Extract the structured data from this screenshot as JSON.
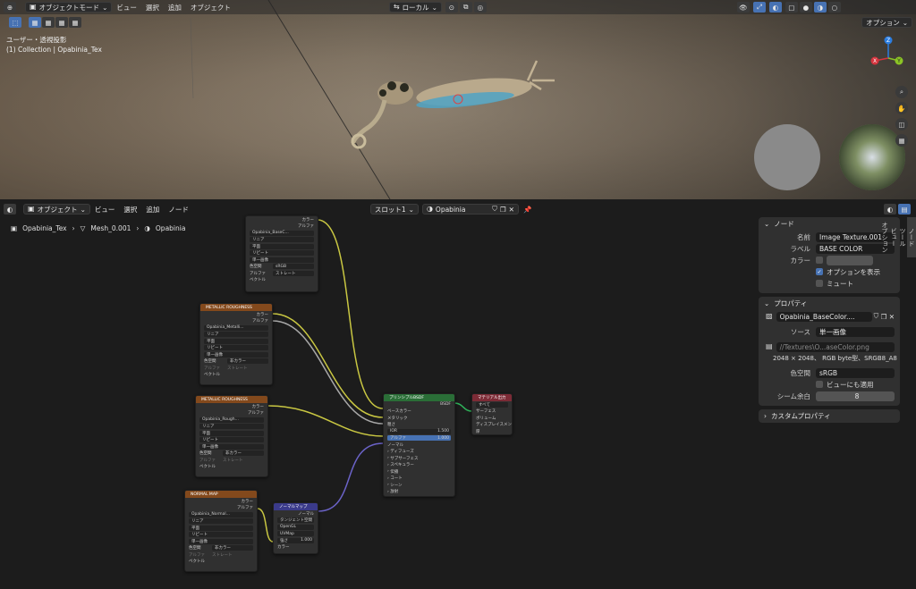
{
  "viewport_header": {
    "mode": "オブジェクトモード",
    "menus": [
      "ビュー",
      "選択",
      "追加",
      "オブジェクト"
    ],
    "pivot": "ローカル",
    "options": "オプション"
  },
  "viewport": {
    "view_name": "ユーザー・透視投影",
    "collection": "(1) Collection | Opabinia_Tex",
    "gizmo": {
      "x": "X",
      "y": "Y",
      "z": "Z"
    }
  },
  "node_header": {
    "mode": "オブジェクト",
    "menus": [
      "ビュー",
      "選択",
      "追加",
      "ノード"
    ],
    "slot": "スロット1",
    "material": "Opabinia"
  },
  "breadcrumb": [
    "Opabinia_Tex",
    "Mesh_0.001",
    "Opabinia"
  ],
  "nodes": {
    "tex1": {
      "title": "",
      "out_color": "カラー",
      "out_alpha": "アルファ",
      "image": "Opabinia_BaseC...",
      "interp": "リニア",
      "proj": "平面",
      "ext": "リピート",
      "src": "単一画像",
      "cs_label": "色空間",
      "cs": "sRGB",
      "a_label": "アルファ",
      "a": "ストレート",
      "vector": "ベクトル"
    },
    "tex2": {
      "title": "METALLIC ROUGHNESS",
      "out_color": "カラー",
      "out_alpha": "アルファ",
      "image": "Opabinia_Metalli...",
      "interp": "リニア",
      "proj": "平面",
      "ext": "リピート",
      "src": "単一画像",
      "cs_label": "色空間",
      "cs": "非カラー",
      "a_label": "アルファ",
      "a": "ストレート",
      "vector": "ベクトル"
    },
    "tex3": {
      "title": "METALLIC ROUGHNESS",
      "out_color": "カラー",
      "out_alpha": "アルファ",
      "image": "Opabinia_Rough...",
      "interp": "リニア",
      "proj": "平面",
      "ext": "リピート",
      "src": "単一画像",
      "cs_label": "色空間",
      "cs": "非カラー",
      "a_label": "アルファ",
      "a": "ストレート",
      "vector": "ベクトル"
    },
    "tex4": {
      "title": "NORMAL MAP",
      "out_color": "カラー",
      "out_alpha": "アルファ",
      "image": "Opabinia_Normal...",
      "interp": "リニア",
      "proj": "平面",
      "ext": "リピート",
      "src": "単一画像",
      "cs_label": "色空間",
      "cs": "非カラー",
      "a_label": "アルファ",
      "a": "ストレート",
      "vector": "ベクトル"
    },
    "normalmap": {
      "title": "ノーマルマップ",
      "out": "ノーマル",
      "space": "タンジェント空間",
      "conv": "OpenGL",
      "uv": "UVMap",
      "strength_label": "強さ",
      "strength": "1.000",
      "color": "カラー"
    },
    "bsdf": {
      "title": "プリンシプルBSDF",
      "out": "BSDF",
      "base": "ベースカラー",
      "metallic": "メタリック",
      "rough": "粗さ",
      "ior_label": "IOR",
      "ior": "1.500",
      "alpha_label": "アルファ",
      "alpha": "1.000",
      "normal": "ノーマル",
      "sub": [
        "ディフューズ",
        "サブサーフェス",
        "スペキュラー",
        "伝播",
        "コート",
        "シーン",
        "放射",
        "薄膜"
      ]
    },
    "output": {
      "title": "マテリアル出力",
      "target": "すべて",
      "surface": "サーフェス",
      "volume": "ボリューム",
      "disp": "ディスプレイスメント",
      "thick": "厚"
    }
  },
  "side_panel": {
    "node_panel": {
      "title": "ノード",
      "name_label": "名前",
      "name": "Image Texture.001",
      "label_label": "ラベル",
      "label": "BASE COLOR",
      "color_label": "カラー",
      "show_options": "オプションを表示",
      "mute": "ミュート"
    },
    "props_panel": {
      "title": "プロパティ",
      "image": "Opabinia_BaseColor....",
      "source_label": "ソース",
      "source": "単一画像",
      "path": "//Textures\\O...aseColor.png",
      "info": "2048 × 2048、 RGB byte型、SRGB8_A8",
      "cs_label": "色空間",
      "cs": "sRGB",
      "view_transform": "ビューにも適用",
      "seam_label": "シーム余白",
      "seam": "8"
    },
    "custom_panel": {
      "title": "カスタムプロパティ"
    },
    "tabs": [
      "ノード",
      "ツール",
      "ビュー",
      "オプション"
    ]
  },
  "colors": {
    "accent": "#4772b3",
    "tex_header": "#83491c",
    "bsdf_header": "#2a6e37",
    "output_header": "#7c2b36",
    "vector_header": "#3a3a8a",
    "link_yellow": "#c9c742",
    "link_gray": "#a8a8a8",
    "link_purple": "#6b63c8"
  }
}
